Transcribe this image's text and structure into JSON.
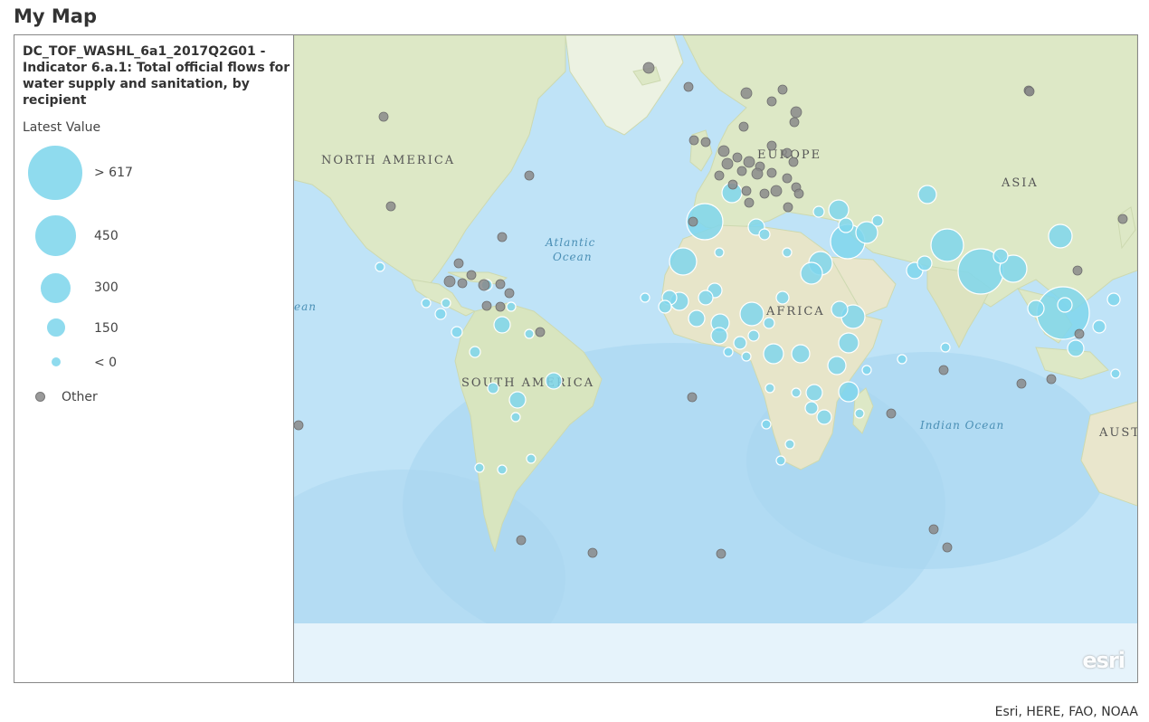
{
  "page": {
    "title": "My Map"
  },
  "legend": {
    "layer_title": "DC_TOF_WASHL_6a1_2017Q2G01 - Indicator 6.a.1: Total official flows for water supply and sanitation, by recipient",
    "field_label": "Latest Value",
    "classes": [
      {
        "label": "> 617"
      },
      {
        "label": "450"
      },
      {
        "label": "300"
      },
      {
        "label": "150"
      },
      {
        "label": "< 0"
      }
    ],
    "other_label": "Other"
  },
  "map": {
    "labels": {
      "north_america": "NORTH AMERICA",
      "south_america": "SOUTH AMERICA",
      "europe": "EUROPE",
      "asia": "ASIA",
      "africa": "AFRICA",
      "aust": "AUST",
      "atlantic_1": "Atlantic",
      "atlantic_2": "Ocean",
      "indian": "Indian Ocean",
      "ocean_left": "ean"
    },
    "colors": {
      "ocean": "#b8dff5",
      "land": "#dfe9c8",
      "symbol": "#7fd6ec",
      "other": "#8a8a8a"
    },
    "logo": "esri",
    "attribution": "Esri, HERE, FAO, NOAA"
  }
}
